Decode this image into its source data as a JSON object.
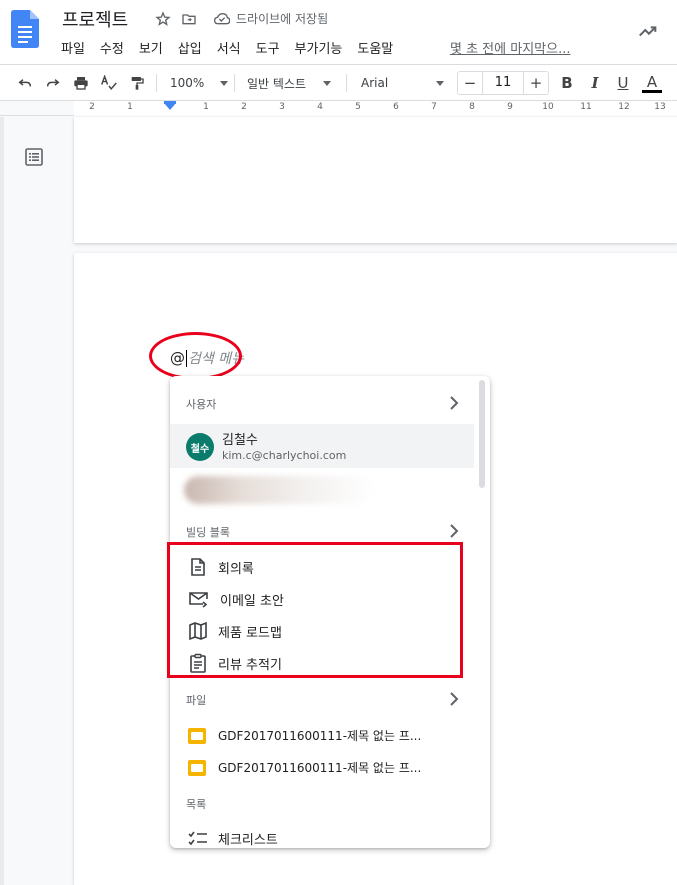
{
  "doc": {
    "title": "프로젝트",
    "saved_status": "드라이브에 저장됨",
    "last_edit": "몇 초 전에 마지막으...",
    "colors": {
      "docs_blue": "#4285f4",
      "annotation_red": "#e8001c",
      "avatar_teal": "#0b7b6b",
      "slides_yellow": "#f4b400"
    }
  },
  "menu": [
    "파일",
    "수정",
    "보기",
    "삽입",
    "서식",
    "도구",
    "부가기능",
    "도움말"
  ],
  "toolbar": {
    "zoom": "100%",
    "style": "일반 텍스트",
    "font": "Arial",
    "font_size": "11",
    "minus": "−",
    "plus": "+",
    "bold": "B",
    "italic": "I",
    "underline": "U",
    "text_color": "A"
  },
  "ruler": {
    "labels": [
      "2",
      "1",
      "1",
      "2",
      "3",
      "4",
      "5",
      "6",
      "7",
      "8",
      "9",
      "10",
      "11",
      "12",
      "13"
    ]
  },
  "editor": {
    "at_symbol": "@",
    "placeholder": "검색 메뉴"
  },
  "popup": {
    "users_header": "사용자",
    "user": {
      "avatar_text": "철수",
      "name": "김철수",
      "email": "kim.c@charlychoi.com"
    },
    "building_blocks_header": "빌딩 블록",
    "building_blocks": [
      {
        "label": "회의록",
        "icon": "document-icon"
      },
      {
        "label": "이메일 초안",
        "icon": "email-draft-icon"
      },
      {
        "label": "제품 로드맵",
        "icon": "map-icon"
      },
      {
        "label": "리뷰 추적기",
        "icon": "clipboard-icon"
      }
    ],
    "files_header": "파일",
    "files": [
      {
        "label": "GDF2017011600111-제목 없는 프...",
        "icon": "slides-icon"
      },
      {
        "label": "GDF2017011600111-제목 없는 프...",
        "icon": "slides-icon"
      }
    ],
    "lists_header": "목록",
    "lists": [
      {
        "label": "체크리스트",
        "icon": "checklist-icon"
      }
    ]
  }
}
